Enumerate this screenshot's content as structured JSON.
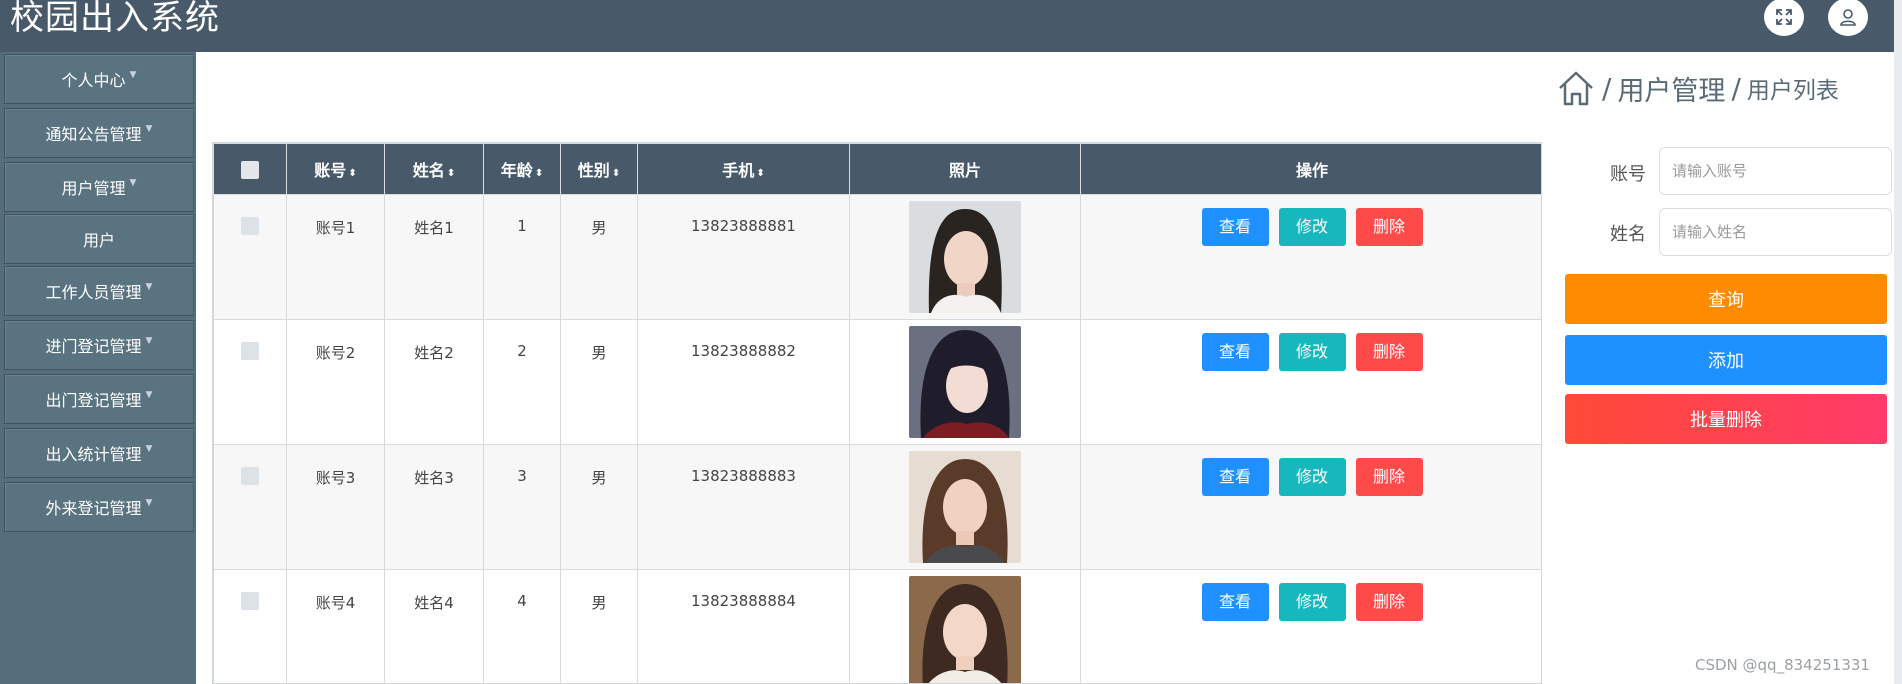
{
  "app": {
    "title": "校园出入系统"
  },
  "header": {
    "fullscreen_icon": "expand-icon",
    "user_icon": "user-icon"
  },
  "sidebar": {
    "items": [
      {
        "label": "个人中心",
        "has_caret": true
      },
      {
        "label": "通知公告管理",
        "has_caret": true
      },
      {
        "label": "用户管理",
        "has_caret": true
      },
      {
        "label": "用户",
        "has_caret": false
      },
      {
        "label": "工作人员管理",
        "has_caret": true
      },
      {
        "label": "进门登记管理",
        "has_caret": true
      },
      {
        "label": "出门登记管理",
        "has_caret": true
      },
      {
        "label": "出入统计管理",
        "has_caret": true
      },
      {
        "label": "外来登记管理",
        "has_caret": true
      }
    ]
  },
  "breadcrumb": {
    "home_icon": "home-icon",
    "separator": "/",
    "level1": "用户管理",
    "level2": "用户列表"
  },
  "table": {
    "headers": [
      "账号",
      "姓名",
      "年龄",
      "性别",
      "手机",
      "照片",
      "操作"
    ],
    "sort_glyph": "⬍",
    "rows": [
      {
        "account": "账号1",
        "name": "姓名1",
        "age": "1",
        "gender": "男",
        "phone": "13823888881"
      },
      {
        "account": "账号2",
        "name": "姓名2",
        "age": "2",
        "gender": "男",
        "phone": "13823888882"
      },
      {
        "account": "账号3",
        "name": "姓名3",
        "age": "3",
        "gender": "男",
        "phone": "13823888883"
      },
      {
        "account": "账号4",
        "name": "姓名4",
        "age": "4",
        "gender": "男",
        "phone": "13823888884"
      }
    ],
    "actions": {
      "view": "查看",
      "edit": "修改",
      "delete": "删除"
    }
  },
  "search": {
    "account_label": "账号",
    "account_placeholder": "请输入账号",
    "name_label": "姓名",
    "name_placeholder": "请输入姓名",
    "query_button": "查询",
    "add_button": "添加",
    "batch_delete_button": "批量删除"
  },
  "watermark": "CSDN @qq_834251331",
  "colors": {
    "header_bg": "#485a6a",
    "sidebar_bg": "#566d7b",
    "view": "#1e90ff",
    "edit": "#17b8bd",
    "delete": "#ff4a4a",
    "query": "#ff8c00",
    "add": "#1e90ff",
    "batch_delete": "#ff4a4a"
  }
}
